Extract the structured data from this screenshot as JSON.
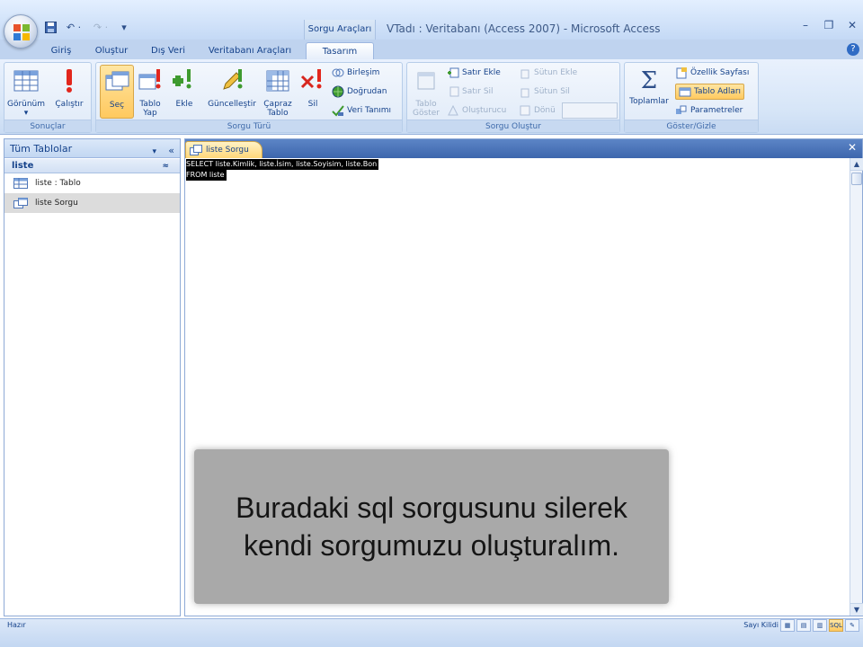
{
  "window": {
    "context_label": "Sorgu Araçları",
    "title": "VTadı : Veritabanı (Access 2007) - Microsoft Access",
    "minimize": "–",
    "restore": "❐",
    "close": "✕"
  },
  "quick_access": {
    "save_icon": "save-icon",
    "undo": "↶ ·",
    "redo": "↷ ·",
    "customize": "▾"
  },
  "tabs": [
    {
      "label": "Giriş"
    },
    {
      "label": "Oluştur"
    },
    {
      "label": "Dış Veri"
    },
    {
      "label": "Veritabanı Araçları"
    },
    {
      "label": "Tasarım"
    }
  ],
  "help": "?",
  "ribbon": {
    "results": {
      "label": "Sonuçlar",
      "view": "Görünüm",
      "view_arrow": "▾",
      "run": "Çalıştır"
    },
    "query_type": {
      "label": "Sorgu Türü",
      "select": "Seç",
      "make_table_1": "Tablo",
      "make_table_2": "Yap",
      "append": "Ekle",
      "update": "Güncelleştir",
      "crosstab_1": "Çapraz",
      "crosstab_2": "Tablo",
      "delete": "Sil",
      "union": "Birleşim",
      "pass_through": "Doğrudan",
      "data_definition": "Veri Tanımı"
    },
    "query_setup": {
      "label": "Sorgu Oluştur",
      "show_table_1": "Tablo",
      "show_table_2": "Göster",
      "insert_rows": "Satır Ekle",
      "delete_rows": "Satır Sil",
      "builder": "Oluşturucu",
      "insert_columns": "Sütun Ekle",
      "delete_columns": "Sütun Sil",
      "return": "Dönü"
    },
    "show_hide": {
      "label": "Göster/Gizle",
      "totals": "Toplamlar",
      "property_sheet": "Özellik Sayfası",
      "table_names": "Tablo Adları",
      "parameters": "Parametreler"
    }
  },
  "nav": {
    "header": "Tüm Tablolar",
    "dropdown": "▾",
    "shutter": "«",
    "group": "liste",
    "collapse": "≈",
    "items": [
      {
        "label": "liste : Tablo"
      },
      {
        "label": "liste Sorgu"
      }
    ]
  },
  "document": {
    "tab": "liste Sorgu",
    "close": "✕",
    "sql_lines": [
      "SELECT liste.Kimlik, liste.İsim, liste.Soyisim, liste.Bon",
      "FROM liste"
    ]
  },
  "caption": {
    "line1": "Buradaki sql sorgusunu silerek",
    "line2": "kendi sorgumuzu oluşturalım."
  },
  "status": {
    "left": "Hazır",
    "num_lock": "Sayı Kilidi",
    "sql_view": "SQL"
  },
  "colors": {
    "ribbon_bg": "#d6e5f7",
    "accent": "#15428b",
    "selected": "#ffc95f",
    "doc_tab_strip": "#3d66ad"
  }
}
